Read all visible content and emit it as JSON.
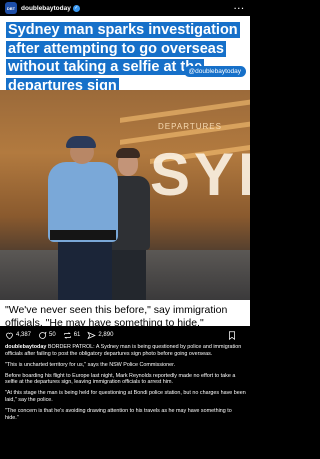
{
  "header": {
    "avatar_text": "DBT",
    "username": "doublebaytoday",
    "verified_mark": "✓",
    "more_label": "···"
  },
  "post_image": {
    "headline": "Sydney man sparks investigation after attempting to go overseas without taking a selfie at the departures sign",
    "source_tag": "@doublebaytoday",
    "sign_text": "DEPARTURES",
    "sign_letters": "SYD",
    "quote": "\"We've never seen this before,\" say immigration officials. \"He may have something to hide.\""
  },
  "actions": {
    "likes": "4,387",
    "comments": "50",
    "reposts": "61",
    "shares": "2,890",
    "icons": [
      "heart-icon",
      "comment-icon",
      "repost-icon",
      "send-icon",
      "bookmark-icon"
    ]
  },
  "caption": {
    "username": "doublebaytoday",
    "intro": "BORDER PATROL: A Sydney man is being questioned by police and immigration officials after failing to post the obligatory departures sign photo before going overseas.",
    "paragraphs": [
      "\"This is uncharted territory for us,\" says the NSW Police Commissioner.",
      "Before boarding his flight to Europe last night, Mark Reynolds reportedly made no effort to take a selfie at the departures sign, leaving immigration officials to arrest him.",
      "\"At this stage the man is being held for questioning at Bondi police station, but no charges have been laid,\" say the police.",
      "\"The concern is that he's avoiding drawing attention to his travels as he may have something to hide.\""
    ]
  },
  "colors": {
    "accent_blue": "#1670c9",
    "background": "#000000",
    "verified": "#3897f0"
  }
}
